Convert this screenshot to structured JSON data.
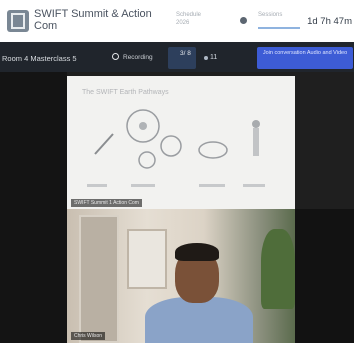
{
  "header": {
    "title": "SWIFT Summit & Action Com",
    "tabs": [
      {
        "label": "Schedule 2026"
      },
      {
        "label": "Sessions",
        "active": true
      }
    ],
    "timer": "1d 7h 47m"
  },
  "infobar": {
    "room": "Room 4 Masterclass 5",
    "recording_label": "Recording",
    "counter": "3/ 8",
    "viewer_count": "11",
    "cta_label": "Join conversation Audio and Video"
  },
  "stage": {
    "slide_heading": "The SWIFT Earth Pathways",
    "slide_label": "SWIFT Summit 1 Action Com",
    "video_label": "Chris Wilson"
  },
  "colors": {
    "accent": "#3d5cd6",
    "tab_underline": "#8fb3df"
  }
}
